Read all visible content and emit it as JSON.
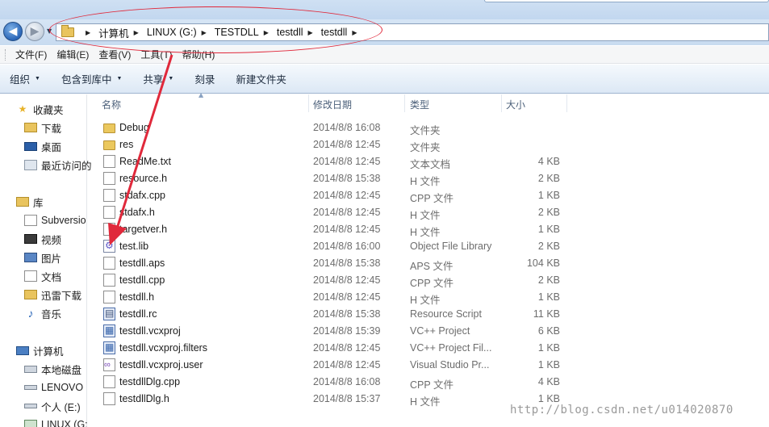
{
  "address_bar": {
    "crumbs": [
      "计算机",
      "LINUX (G:)",
      "TESTDLL",
      "testdll",
      "testdll"
    ]
  },
  "menu": [
    "文件(F)",
    "编辑(E)",
    "查看(V)",
    "工具(T)",
    "帮助(H)"
  ],
  "toolbar": {
    "organize": "组织",
    "include_in_library": "包含到库中",
    "share": "共享",
    "burn": "刻录",
    "new_folder": "新建文件夹"
  },
  "nav_pane": {
    "favorites": "收藏夹",
    "downloads": "下载",
    "desktop": "桌面",
    "recent": "最近访问的",
    "libraries": "库",
    "subversion": "Subversio",
    "videos": "视频",
    "pictures": "图片",
    "documents": "文档",
    "thunder": "迅雷下载",
    "music": "音乐",
    "computer": "计算机",
    "local_disk": "本地磁盘",
    "lenovo": "LENOVO",
    "personal": "个人 (E:)",
    "linux": "LINUX (G:"
  },
  "columns": {
    "name": "名称",
    "modified": "修改日期",
    "type": "类型",
    "size": "大小"
  },
  "files": [
    {
      "name": "Debug",
      "date": "2014/8/8 16:08",
      "type": "文件夹",
      "size": "",
      "icon": "folder-icon"
    },
    {
      "name": "res",
      "date": "2014/8/8 12:45",
      "type": "文件夹",
      "size": "",
      "icon": "folder-icon"
    },
    {
      "name": "ReadMe.txt",
      "date": "2014/8/8 12:45",
      "type": "文本文档",
      "size": "4 KB",
      "icon": "document-icon"
    },
    {
      "name": "resource.h",
      "date": "2014/8/8 15:38",
      "type": "H 文件",
      "size": "2 KB",
      "icon": "document-icon"
    },
    {
      "name": "stdafx.cpp",
      "date": "2014/8/8 12:45",
      "type": "CPP 文件",
      "size": "1 KB",
      "icon": "document-icon"
    },
    {
      "name": "stdafx.h",
      "date": "2014/8/8 12:45",
      "type": "H 文件",
      "size": "2 KB",
      "icon": "document-icon"
    },
    {
      "name": "targetver.h",
      "date": "2014/8/8 12:45",
      "type": "H 文件",
      "size": "1 KB",
      "icon": "document-icon"
    },
    {
      "name": "test.lib",
      "date": "2014/8/8 16:00",
      "type": "Object File Library",
      "size": "2 KB",
      "icon": "library-icon"
    },
    {
      "name": "testdll.aps",
      "date": "2014/8/8 15:38",
      "type": "APS 文件",
      "size": "104 KB",
      "icon": "document-icon"
    },
    {
      "name": "testdll.cpp",
      "date": "2014/8/8 12:45",
      "type": "CPP 文件",
      "size": "2 KB",
      "icon": "document-icon"
    },
    {
      "name": "testdll.h",
      "date": "2014/8/8 12:45",
      "type": "H 文件",
      "size": "1 KB",
      "icon": "document-icon"
    },
    {
      "name": "testdll.rc",
      "date": "2014/8/8 15:38",
      "type": "Resource Script",
      "size": "11 KB",
      "icon": "resource-icon"
    },
    {
      "name": "testdll.vcxproj",
      "date": "2014/8/8 15:39",
      "type": "VC++ Project",
      "size": "6 KB",
      "icon": "project-icon"
    },
    {
      "name": "testdll.vcxproj.filters",
      "date": "2014/8/8 12:45",
      "type": "VC++ Project Fil...",
      "size": "1 KB",
      "icon": "project-icon"
    },
    {
      "name": "testdll.vcxproj.user",
      "date": "2014/8/8 12:45",
      "type": "Visual Studio Pr...",
      "size": "1 KB",
      "icon": "user-settings-icon"
    },
    {
      "name": "testdllDlg.cpp",
      "date": "2014/8/8 16:08",
      "type": "CPP 文件",
      "size": "4 KB",
      "icon": "document-icon"
    },
    {
      "name": "testdllDlg.h",
      "date": "2014/8/8 15:37",
      "type": "H 文件",
      "size": "1 KB",
      "icon": "document-icon"
    }
  ],
  "watermark": "http://blog.csdn.net/u014020870",
  "colors": {
    "annotation_red": "#e0293b",
    "folder_yellow": "#ebc85e",
    "toolbar_blue": "#dce8f5"
  }
}
